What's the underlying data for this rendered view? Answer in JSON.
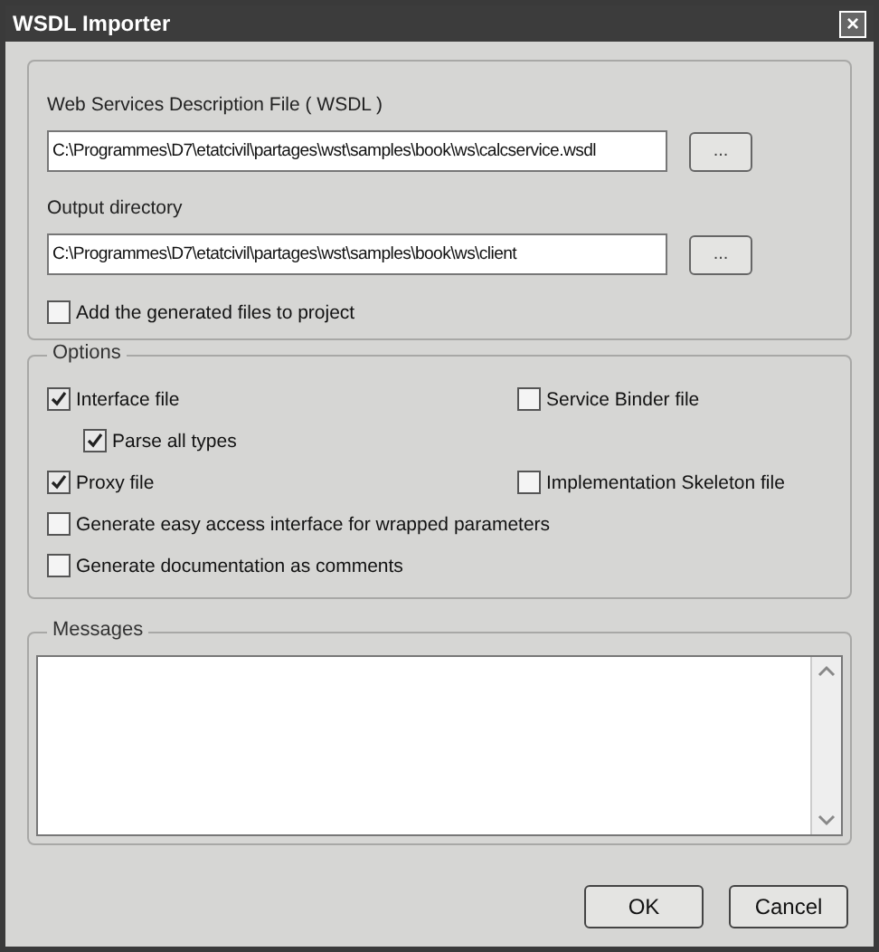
{
  "window": {
    "title": "WSDL Importer",
    "close": "×"
  },
  "source": {
    "label": "Web Services Description File ( WSDL )",
    "value": "C:\\Programmes\\D7\\etatcivil\\partages\\wst\\samples\\book\\ws\\calcservice.wsdl",
    "browse": "..."
  },
  "output": {
    "label": "Output directory",
    "value": "C:\\Programmes\\D7\\etatcivil\\partages\\wst\\samples\\book\\ws\\client",
    "browse": "..."
  },
  "add_to_project": {
    "label": "Add the generated files to project",
    "checked": false
  },
  "options": {
    "title": "Options",
    "rows": [
      {
        "left": {
          "label": "Interface file",
          "checked": true,
          "children": [
            {
              "label": "Parse all types",
              "checked": true
            }
          ]
        },
        "right": {
          "label": "Service Binder file",
          "checked": false
        }
      },
      {
        "left": {
          "label": "Proxy file",
          "checked": true
        },
        "right": {
          "label": "Implementation Skeleton file",
          "checked": false
        }
      },
      {
        "left": {
          "label": "Generate easy access interface for wrapped parameters",
          "checked": false
        }
      },
      {
        "left": {
          "label": "Generate documentation as comments",
          "checked": false
        }
      }
    ]
  },
  "messages": {
    "title": "Messages"
  },
  "buttons": [
    "OK",
    "Cancel"
  ]
}
